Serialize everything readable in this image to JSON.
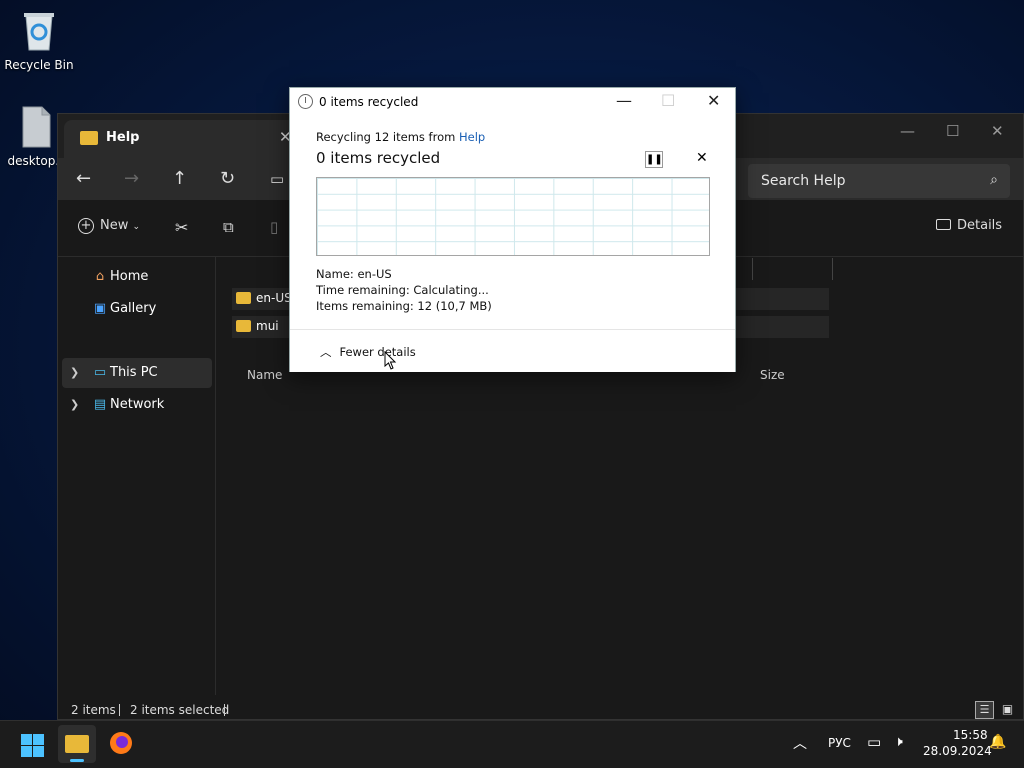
{
  "desktop": {
    "icons": [
      {
        "label": "Recycle Bin"
      },
      {
        "label": "desktop.i"
      }
    ]
  },
  "explorer": {
    "tab_title": "Help",
    "search_placeholder": "Search Help",
    "toolbar": {
      "new_label": "New",
      "details_label": "Details"
    },
    "sidebar": [
      {
        "label": "Home"
      },
      {
        "label": "Gallery"
      },
      {
        "label": "This PC"
      },
      {
        "label": "Network"
      }
    ],
    "columns": {
      "name": "Name",
      "size": "Size"
    },
    "files": [
      {
        "name": "en-US"
      },
      {
        "name": "mui"
      }
    ],
    "status": {
      "items": "2 items",
      "selected": "2 items selected"
    }
  },
  "dialog": {
    "title": "0 items recycled",
    "recycling_prefix": "Recycling 12 items from ",
    "recycling_link": "Help",
    "heading": "0 items recycled",
    "name_line": "Name:  en-US",
    "time_line": "Time remaining:  Calculating...",
    "items_line": "Items remaining:  12 (10,7 MB)",
    "fewer_details": "Fewer details",
    "progress_percent": 0,
    "link_color": "#1a5fb4"
  },
  "taskbar": {
    "lang": "РУС",
    "time": "15:58",
    "date": "28.09.2024"
  },
  "colors": {
    "folder": "#e8b839",
    "accent": "#4aa3ff"
  }
}
